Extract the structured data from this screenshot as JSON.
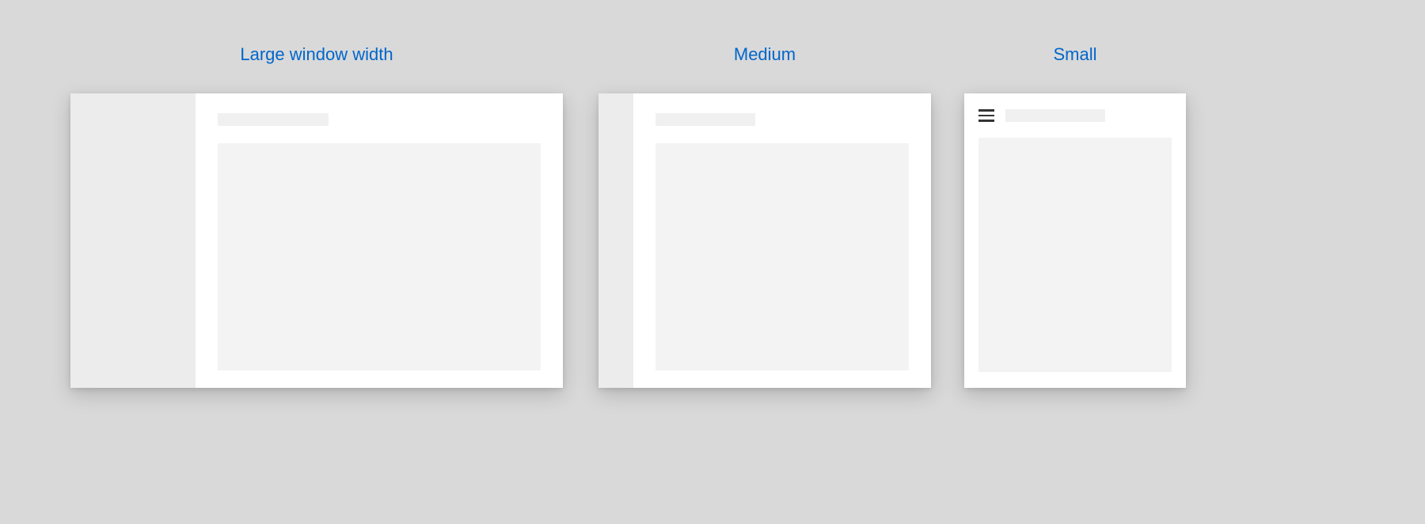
{
  "labels": {
    "large": "Large window width",
    "medium": "Medium",
    "small": "Small"
  }
}
